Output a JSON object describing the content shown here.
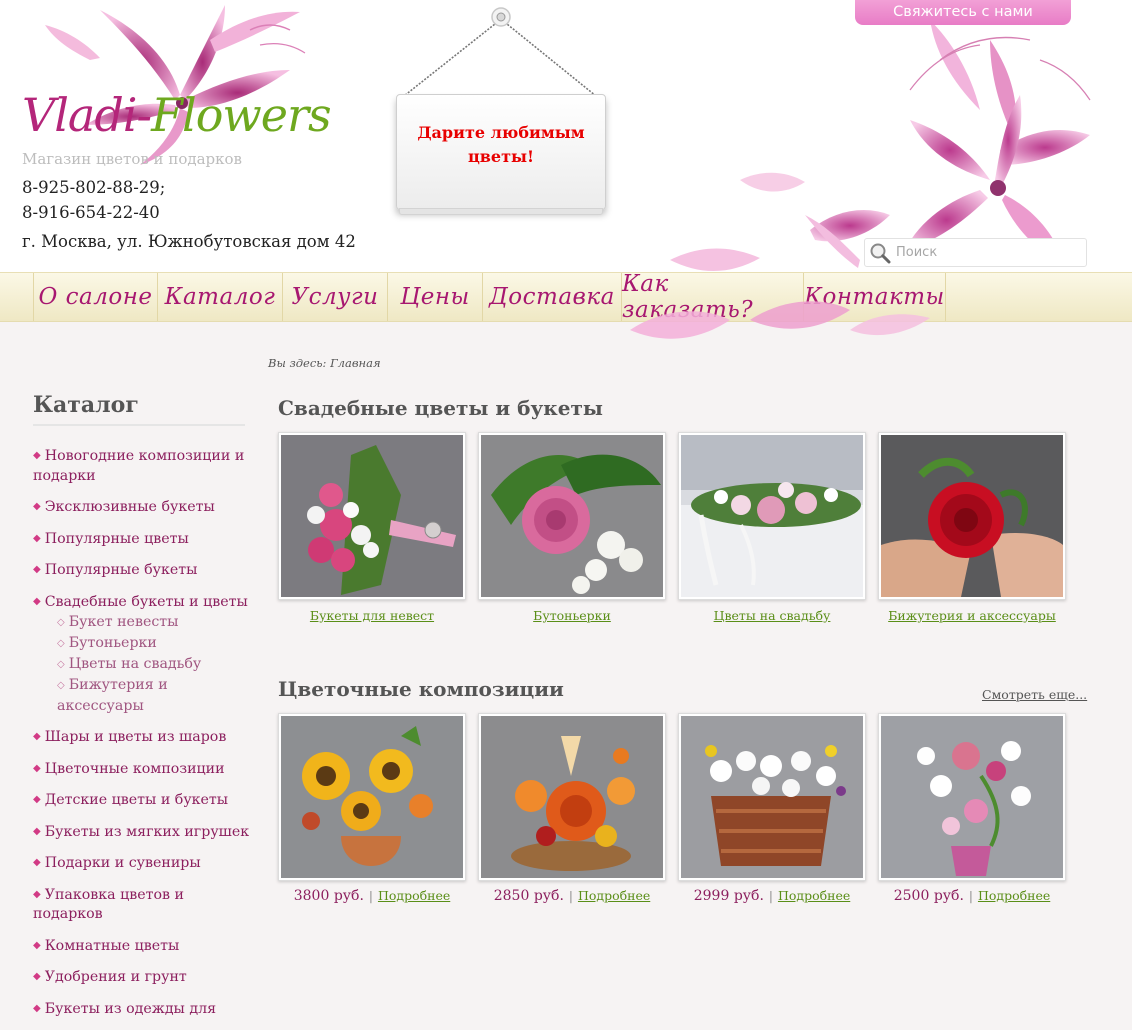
{
  "header": {
    "logo_part1": "Vladi-",
    "logo_part2": "Flowers",
    "tagline": "Магазин цветов и подарков",
    "phone1": "8-925-802-88-29;",
    "phone2": "8-916-654-22-40",
    "address": "г. Москва, ул. Южнобутовская дом 42",
    "sign_text": "Дарите любимым цветы!",
    "contact_button": "Свяжитесь с нами",
    "search_placeholder": "Поиск"
  },
  "nav": {
    "items": [
      "О салоне",
      "Каталог",
      "Услуги",
      "Цены",
      "Доставка",
      "Как заказать?",
      "Контакты"
    ]
  },
  "breadcrumb": "Вы здесь: Главная",
  "sidebar": {
    "title": "Каталог",
    "items": [
      "Новогодние композиции и подарки",
      "Эксклюзивные букеты",
      "Популярные цветы",
      "Популярные букеты",
      "Свадебные букеты и цветы",
      "Шары и цветы из шаров",
      "Цветочные композиции",
      "Детские цветы и букеты",
      "Букеты из мягких игрушек",
      "Подарки и сувениры",
      "Упаковка цветов и подарков",
      "Комнатные цветы",
      "Удобрения и грунт",
      "Букеты из одежды для"
    ],
    "wedding_subitems": [
      "Букет невесты",
      "Бутоньерки",
      "Цветы на свадьбу",
      "Бижутерия и аксессуары"
    ]
  },
  "section_wedding": {
    "title": "Свадебные цветы и букеты",
    "cards": [
      {
        "label": "Букеты для невест"
      },
      {
        "label": "Бутоньерки"
      },
      {
        "label": "Цветы на свадьбу"
      },
      {
        "label": "Бижутерия и аксессуары"
      }
    ]
  },
  "section_compositions": {
    "title": "Цветочные композиции",
    "see_more": "Смотреть еще...",
    "more_label": "Подробнее",
    "cards": [
      {
        "price": "3800 руб."
      },
      {
        "price": "2850 руб."
      },
      {
        "price": "2999 руб."
      },
      {
        "price": "2500 руб."
      }
    ]
  },
  "colors": {
    "brand_pink": "#a71770",
    "brand_green": "#6ea81f",
    "link_green": "#5a8e17",
    "sign_red": "#e80000",
    "contact_pink": "#e87cc6"
  }
}
